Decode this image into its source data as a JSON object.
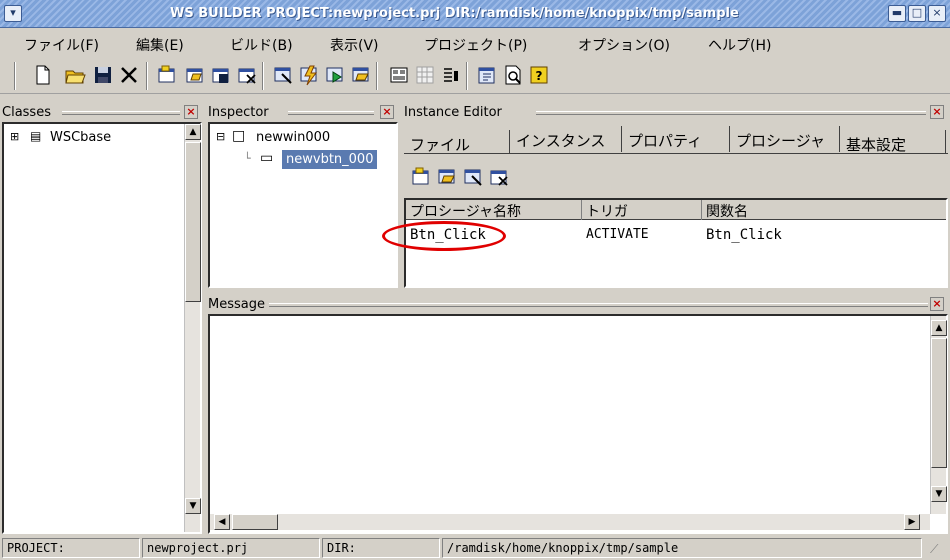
{
  "window": {
    "title": "WS BUILDER PROJECT:newproject.prj DIR:/ramdisk/home/knoppix/tmp/sample"
  },
  "menu": [
    "ファイル(F)",
    "編集(E)",
    "ビルド(B)",
    "表示(V)",
    "プロジェクト(P)",
    "オプション(O)",
    "ヘルプ(H)"
  ],
  "toolbar": {
    "icons": [
      "new-file-icon",
      "open-folder-icon",
      "save-icon",
      "delete-icon",
      "new-window-icon",
      "open-window-icon",
      "save-window-icon",
      "delete-window-icon",
      "new-instance-icon",
      "build-icon",
      "run-icon",
      "search-icon",
      "layout-icon",
      "grid-icon",
      "list-icon",
      "inspect-icon",
      "preview-icon",
      "help-icon"
    ]
  },
  "classes": {
    "title": "Classes",
    "items": [
      {
        "label": "WSCbase",
        "icon": "class-icon"
      }
    ]
  },
  "inspector": {
    "title": "Inspector",
    "items": [
      {
        "label": "newwin000",
        "icon": "window-icon"
      },
      {
        "label": "newvbtn_000",
        "icon": "button-icon",
        "selected": true
      }
    ]
  },
  "instance_editor": {
    "title": "Instance Editor",
    "tabs": [
      "ファイル",
      "インスタンス",
      "プロパティ",
      "プロシージャ",
      "基本設定"
    ],
    "active_tab": "プロシージャ",
    "columns": [
      "プロシージャ名称",
      "トリガ",
      "関数名"
    ],
    "rows": [
      {
        "name": "Btn_Click",
        "trigger": "ACTIVATE",
        "function": "Btn_Click"
      }
    ],
    "highlight_color": "#e00000"
  },
  "message": {
    "title": "Message"
  },
  "status": {
    "project_label": "PROJECT:",
    "project_value": "newproject.prj",
    "dir_label": "DIR:",
    "dir_value": "/ramdisk/home/knoppix/tmp/sample"
  }
}
